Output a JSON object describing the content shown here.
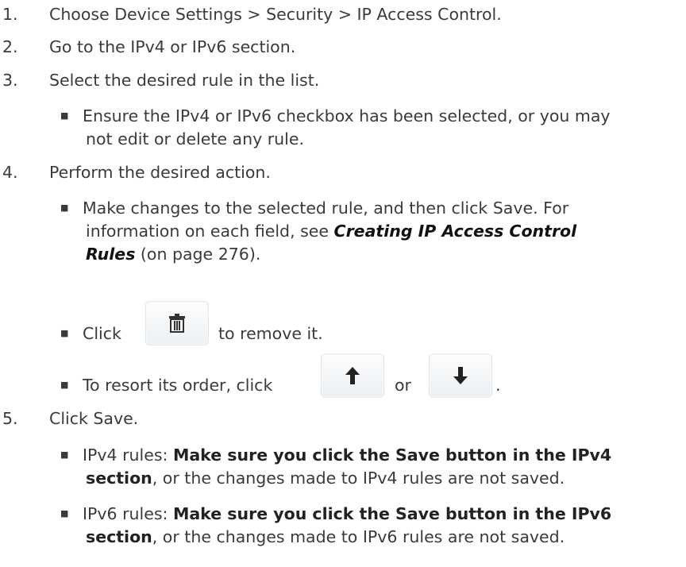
{
  "steps": [
    {
      "num": "1.",
      "text": "Choose Device Settings > Security > IP Access Control."
    },
    {
      "num": "2.",
      "text": "Go to the IPv4 or IPv6 section."
    },
    {
      "num": "3.",
      "text": "Select the desired rule in the list."
    },
    {
      "num": "4.",
      "text": "Perform the desired action."
    },
    {
      "num": "5.",
      "text": "Click Save."
    }
  ],
  "step3_note": {
    "line1": "Ensure the IPv4 or IPv6 checkbox has been selected, or you may",
    "line2": "not edit or delete any rule."
  },
  "step4_items": {
    "edit": {
      "line1": "Make changes to the selected rule, and then click Save. For",
      "line2_pre": "information on each field, see ",
      "link_part1": "Creating IP Access Control",
      "link_part2": "Rules",
      "link_suffix": " (on page 276)."
    },
    "delete": {
      "pre": "Click",
      "post": "to remove it.",
      "icon": "trash-icon"
    },
    "resort": {
      "pre": "To resort its order, click",
      "mid": "or",
      "post": ".",
      "icons": [
        "arrow-up-icon",
        "arrow-down-icon"
      ]
    }
  },
  "step5_items": {
    "ipv4": {
      "label": "IPv4 rules: ",
      "bold1": "Make sure you click the Save button in the IPv4",
      "bold2": "section",
      "rest": ", or the changes made to IPv4 rules are not saved."
    },
    "ipv6": {
      "label": "IPv6 rules: ",
      "bold1": "Make sure you click the Save button in the IPv6",
      "bold2": "section",
      "rest": ", or the changes made to IPv6 rules are not saved."
    }
  },
  "bullet_char": "■"
}
